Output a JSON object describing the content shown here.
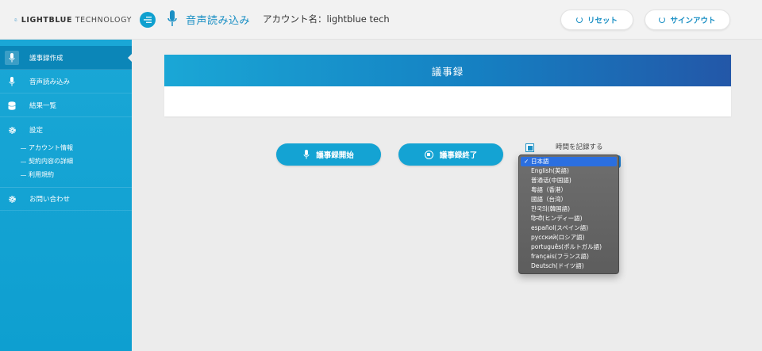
{
  "header": {
    "logo_strong": "LIGHTBLUE",
    "logo_light": " TECHNOLOGY",
    "page_title": "音声読み込み",
    "account_label": "アカウント名：lightblue tech",
    "reset_label": "リセット",
    "signout_label": "サインアウト"
  },
  "sidebar": {
    "items": [
      {
        "label": "議事録作成",
        "icon": "mic-icon"
      },
      {
        "label": "音声読み込み",
        "icon": "mic-icon"
      },
      {
        "label": "結果一覧",
        "icon": "database-icon"
      },
      {
        "label": "設定",
        "icon": "gear-icon"
      },
      {
        "label": "お問い合わせ",
        "icon": "gear-icon"
      }
    ],
    "settings_sub": [
      "アカウント情報",
      "契約内容の詳細",
      "利用規約"
    ]
  },
  "main": {
    "panel_title": "議事録",
    "start_label": "議事録開始",
    "stop_label": "議事録終了",
    "record_time_label": "時間を記録する"
  },
  "language_dropdown": {
    "selected": "日本語",
    "checkmark": "✓",
    "options": [
      "日本語",
      "English(英語)",
      "普通话(中国語)",
      "粤語（香港）",
      "國語（台湾）",
      "한국의(韓国語)",
      "हिन्दी(ヒンディー語)",
      "español(スペイン語)",
      "русский(ロシア語)",
      "português(ポルトガル語)",
      "français(フランス語)",
      "Deutsch(ドイツ語)"
    ]
  },
  "colors": {
    "accent": "#1aa7d6",
    "sidebar_active": "#0b86b8",
    "dropdown_highlight": "#2b6fe0"
  }
}
